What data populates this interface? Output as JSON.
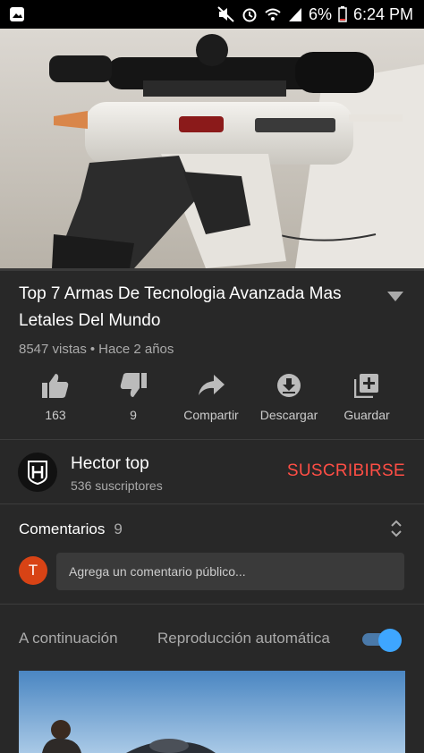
{
  "status_bar": {
    "battery_percent": "6%",
    "time": "6:24 PM",
    "icons": [
      "gallery-icon",
      "mute-icon",
      "alarm-icon",
      "wifi-icon",
      "signal-icon",
      "battery-icon"
    ]
  },
  "video": {
    "title": "Top 7 Armas De Tecnologia Avanzada Mas Letales Del Mundo",
    "views": "8547 vistas",
    "separator": "•",
    "age": "Hace 2 años"
  },
  "actions": [
    {
      "icon": "thumbs-up-icon",
      "label": "163"
    },
    {
      "icon": "thumbs-down-icon",
      "label": "9"
    },
    {
      "icon": "share-icon",
      "label": "Compartir"
    },
    {
      "icon": "download-icon",
      "label": "Descargar"
    },
    {
      "icon": "add-to-playlist-icon",
      "label": "Guardar"
    }
  ],
  "channel": {
    "name": "Hector top",
    "subscribers": "536 suscriptores",
    "subscribe_label": "SUSCRIBIRSE"
  },
  "comments": {
    "heading": "Comentarios",
    "count": "9",
    "avatar_initial": "T",
    "placeholder": "Agrega un comentario público..."
  },
  "up_next": {
    "label": "A continuación",
    "autoplay_label": "Reproducción automática",
    "autoplay_on": true
  },
  "colors": {
    "background": "#282828",
    "subscribe": "#ff4e45",
    "toggle_knob": "#3ea6ff",
    "user_avatar": "#d84315"
  }
}
